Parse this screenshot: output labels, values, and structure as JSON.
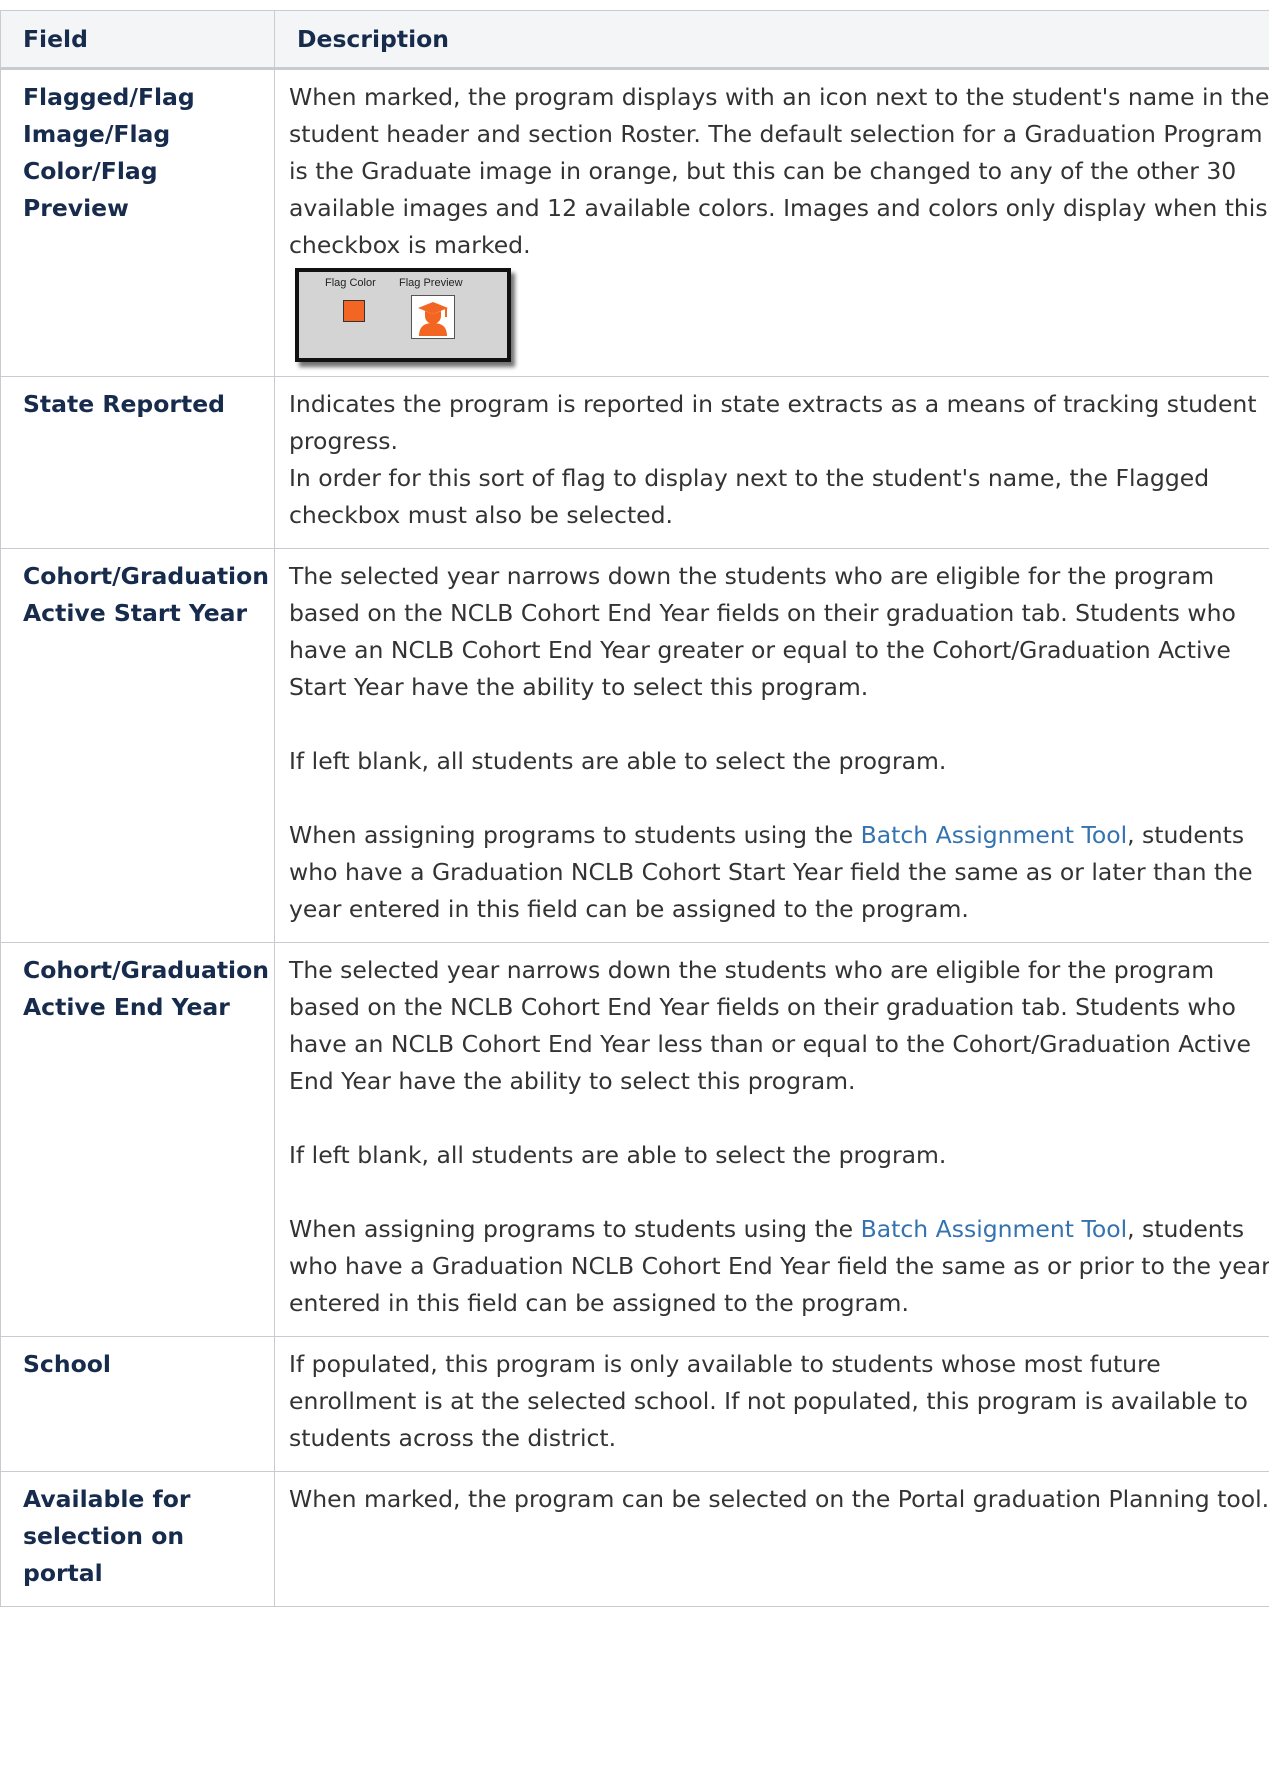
{
  "table": {
    "headers": {
      "field": "Field",
      "description": "Description"
    },
    "rows": [
      {
        "field": "Flagged/Flag Image/Flag Color/Flag Preview",
        "description": "When marked, the program displays with an icon next to the student's name in the student header and section Roster. The default selection for a Graduation Program is the Graduate image in orange, but this can be changed to any of the other 30 available images and 12 available colors. Images and colors only display when this checkbox is marked.",
        "thumbnail": {
          "flag_color_label": "Flag Color",
          "flag_preview_label": "Flag Preview",
          "color": "#f26522",
          "icon": "graduate-icon"
        }
      },
      {
        "field": "State Reported",
        "description_p1": "Indicates the program is reported in state extracts as a means of tracking student progress.",
        "description_p2": "In order for this sort of flag to display next to the student's name, the Flagged checkbox must also be selected."
      },
      {
        "field": "Cohort/Graduation Active Start Year",
        "p1": "The selected year narrows down the students who are eligible for the program based on the NCLB Cohort End Year fields on their graduation tab. Students who have an NCLB Cohort End Year greater or equal to the Cohort/Graduation Active Start Year have the ability to select this program.",
        "p2": "If left blank, all students are able to select the program.",
        "p3_before": "When assigning programs to students using the ",
        "p3_link": "Batch Assignment Tool",
        "p3_after": ", students who have a Graduation NCLB Cohort Start Year field the same as or later than the year entered in this field can be assigned to the program."
      },
      {
        "field": "Cohort/Graduation Active End Year",
        "p1": "The selected year narrows down the students who are eligible for the program based on the NCLB Cohort End Year fields on their graduation tab. Students who have an NCLB Cohort End Year less than or equal to the Cohort/Graduation Active End Year have the ability to select this program.",
        "p2": "If left blank, all students are able to select the program.",
        "p3_before": "When assigning programs to students using the ",
        "p3_link": "Batch Assignment Tool",
        "p3_after": ", students who have a Graduation NCLB Cohort End Year field the same as or prior to the year entered in this field can be assigned to the program."
      },
      {
        "field": "School",
        "description": "If populated, this program is only available to students whose most future enrollment is at the selected school. If not populated, this program is available to students across the district."
      },
      {
        "field": "Available for selection on portal",
        "description": "When marked, the program can be selected on the Portal graduation Planning tool."
      }
    ]
  },
  "colors": {
    "heading_text": "#172b4d",
    "body_text": "#333333",
    "link": "#3572b0",
    "header_bg": "#f4f5f7",
    "border": "#c8ccd1"
  }
}
